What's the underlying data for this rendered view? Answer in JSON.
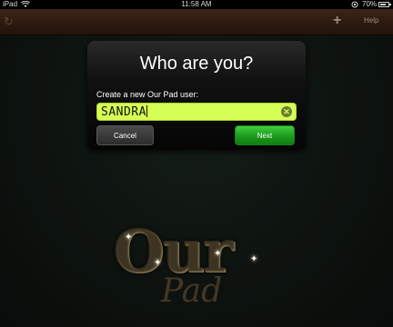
{
  "status_bar": {
    "carrier": "iPad",
    "time": "11:58 AM",
    "battery": "70%",
    "battery_level": 0.7
  },
  "toolbar": {
    "refresh_icon": "refresh-icon",
    "add_icon": "plus-icon",
    "help_label": "Help"
  },
  "dialog": {
    "title": "Who are you?",
    "prompt": "Create a new Our Pad user:",
    "input_value": "SANDRA",
    "cancel_label": "Cancel",
    "next_label": "Next"
  },
  "logo": {
    "line1": "Our",
    "line2": "Pad"
  },
  "colors": {
    "input_bg": "#d6ff55",
    "next_button": "#1c9a1c",
    "toolbar": "#2e1a0f"
  }
}
